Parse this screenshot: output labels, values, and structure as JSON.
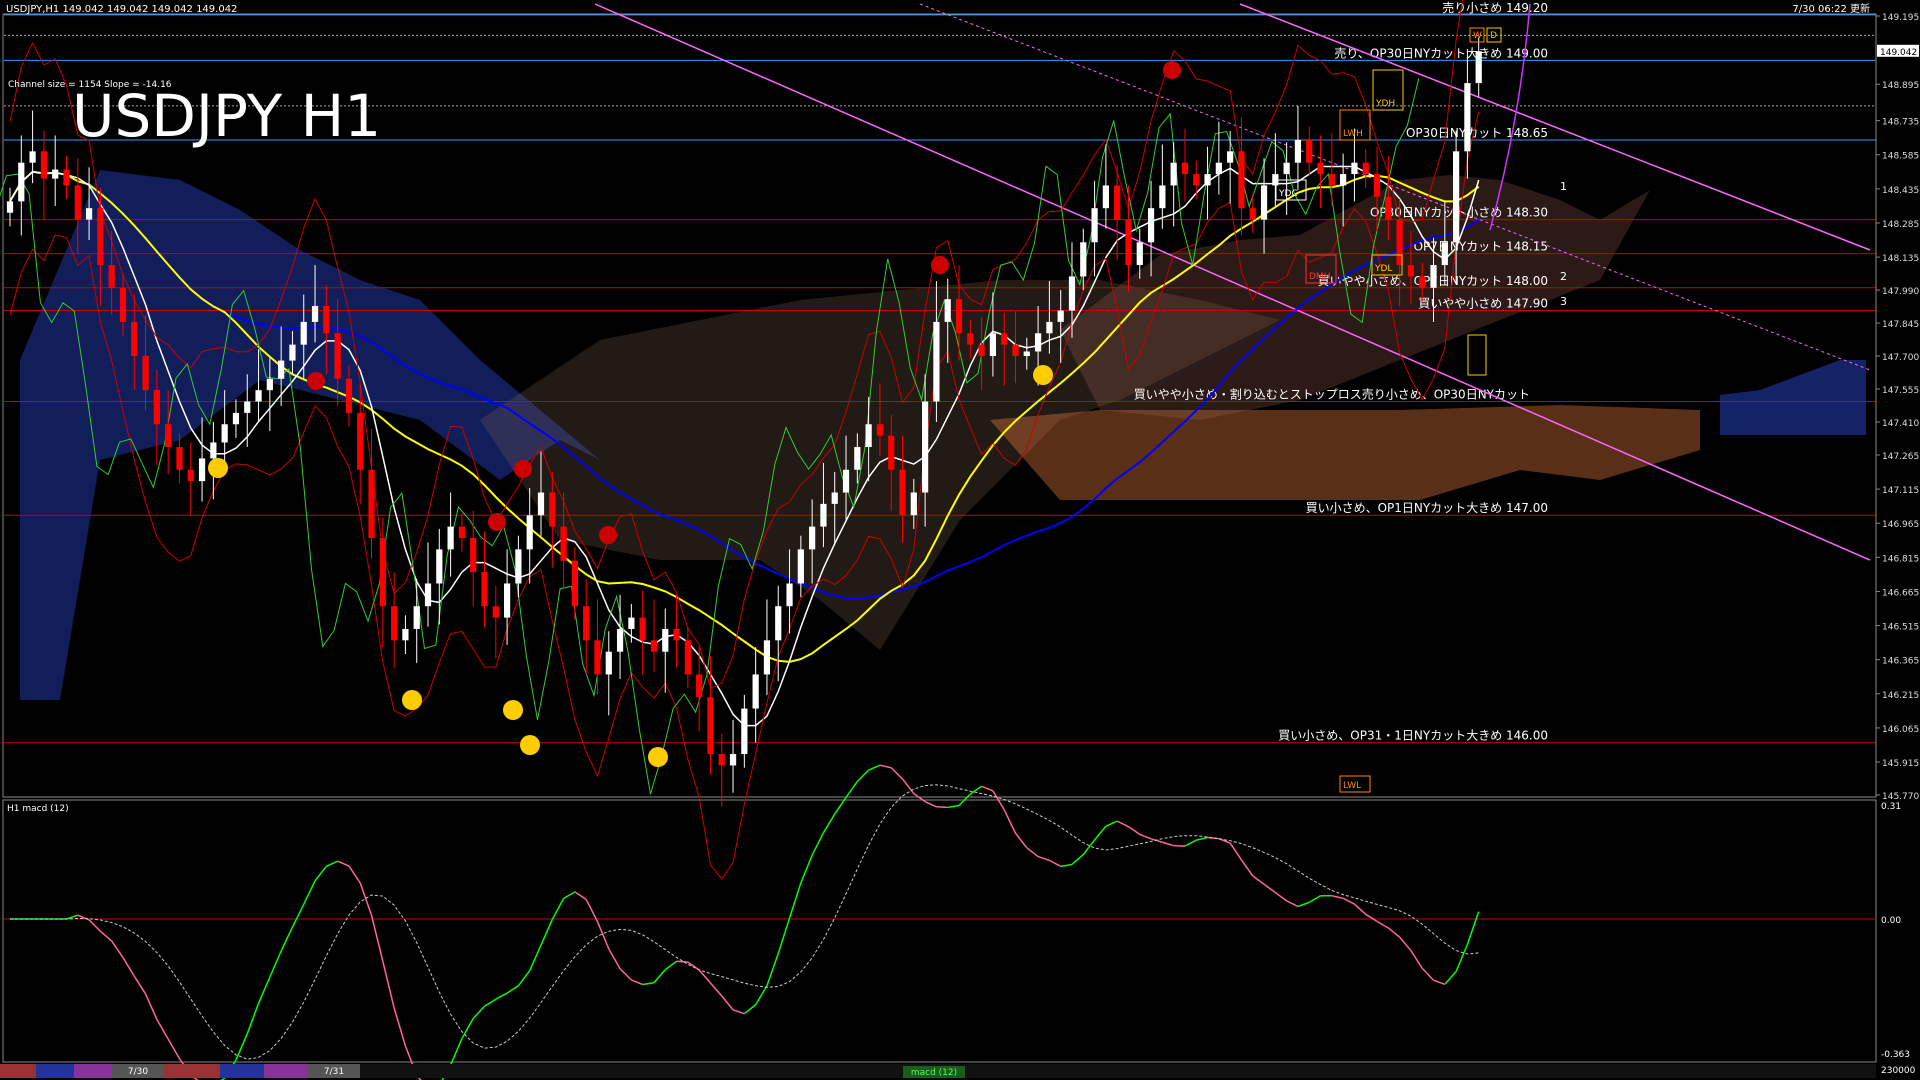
{
  "header": {
    "symbol_info": "USDJPY,H1  149.042 149.042 149.042 149.042",
    "update_time": "7/30 06:22 更新",
    "channel_info": "Channel size = 1154 Slope = -14.16",
    "big_title": "USDJPY H1"
  },
  "indicator": {
    "label": "H1  macd (12)",
    "top_value": "0.31",
    "zero_value": "0.00",
    "bottom_value": "-0.363",
    "bottom_scale": "230000"
  },
  "price_axis": {
    "ticks": [
      "149.195",
      "149.042",
      "148.895",
      "148.735",
      "148.585",
      "148.435",
      "148.285",
      "148.135",
      "147.990",
      "147.845",
      "147.700",
      "147.555",
      "147.410",
      "147.265",
      "147.115",
      "146.965",
      "146.815",
      "146.665",
      "146.515",
      "146.365",
      "146.215",
      "146.065",
      "145.915",
      "145.770"
    ],
    "current_price": "149.042"
  },
  "annotations": [
    {
      "text": "売り小さめ 149.20",
      "level": 149.2,
      "color": "#ffffff"
    },
    {
      "text": "売り、OP30日NYカット大きめ 149.00",
      "level": 149.0,
      "color": "#ffffff"
    },
    {
      "text": "OP30日NYカット 148.65",
      "level": 148.65,
      "color": "#ffffff"
    },
    {
      "text": "OP30日NYカット小さめ 148.30",
      "level": 148.3,
      "color": "#ffffff"
    },
    {
      "text": "OP7日NYカット 148.15",
      "level": 148.15,
      "color": "#ffffff"
    },
    {
      "text": "買いやや小さめ、OP7日NYカット 148.00",
      "level": 148.0,
      "color": "#ffffff"
    },
    {
      "text": "買いやや小さめ 147.90",
      "level": 147.9,
      "color": "#ffffff"
    },
    {
      "text": "買いやや小さめ・割り込むとストップロス売り小さめ、OP30日NYカット",
      "level": 147.5,
      "color": "#ffffff"
    },
    {
      "text": "買い小さめ、OP1日NYカット大きめ 147.00",
      "level": 147.0,
      "color": "#ffffff"
    },
    {
      "text": "買い小さめ、OP31・1日NYカット大きめ 146.00",
      "level": 146.0,
      "color": "#ffffff"
    }
  ],
  "box_labels": [
    "YDH",
    "LWH",
    "YDC",
    "DMH",
    "YDL",
    "LWL",
    "W",
    "D"
  ],
  "channel_marks": [
    "1",
    "2",
    "3"
  ],
  "date_marks": [
    "7/30",
    "7/31"
  ],
  "tab_label": "macd (12)",
  "colors": {
    "bull": "#ffffff",
    "bear": "#ff0000",
    "ma_fast": "#ffffff",
    "ma_mid": "#ffff00",
    "ma_slow": "#0000ff",
    "kumo_blue": "#3355ff",
    "kumo_orange": "#ff8844",
    "channel": "#ff66ff",
    "macd_up": "#00ff00",
    "macd_down": "#ff6699",
    "line_red": "#cc0000",
    "line_blue": "#3399ff"
  },
  "chart_data": {
    "type": "candlestick",
    "title": "USDJPY H1",
    "ylim": [
      145.77,
      149.195
    ],
    "close": [
      148.38,
      148.55,
      148.6,
      148.48,
      148.52,
      148.45,
      148.3,
      148.35,
      148.1,
      148.0,
      147.85,
      147.7,
      147.55,
      147.4,
      147.3,
      147.2,
      147.15,
      147.25,
      147.32,
      147.4,
      147.45,
      147.5,
      147.55,
      147.6,
      147.68,
      147.75,
      147.85,
      147.92,
      147.8,
      147.6,
      147.45,
      147.2,
      146.9,
      146.6,
      146.45,
      146.5,
      146.6,
      146.7,
      146.85,
      146.95,
      146.9,
      146.75,
      146.6,
      146.55,
      146.7,
      146.85,
      147.0,
      147.1,
      146.95,
      146.8,
      146.6,
      146.45,
      146.3,
      146.4,
      146.5,
      146.55,
      146.45,
      146.4,
      146.5,
      146.45,
      146.3,
      146.2,
      145.95,
      145.9,
      145.95,
      146.15,
      146.3,
      146.45,
      146.6,
      146.7,
      146.85,
      146.95,
      147.05,
      147.1,
      147.2,
      147.3,
      147.4,
      147.35,
      147.2,
      147.0,
      147.1,
      147.5,
      147.85,
      147.95,
      147.8,
      147.75,
      147.7,
      147.8,
      147.75,
      147.7,
      147.72,
      147.8,
      147.85,
      147.9,
      148.05,
      148.2,
      148.35,
      148.45,
      148.3,
      148.1,
      148.2,
      148.35,
      148.45,
      148.55,
      148.5,
      148.45,
      148.5,
      148.55,
      148.6,
      148.35,
      148.3,
      148.45,
      148.5,
      148.55,
      148.65,
      148.55,
      148.5,
      148.45,
      148.5,
      148.55,
      148.5,
      148.4,
      148.3,
      148.1,
      148.05,
      148.0,
      148.1,
      148.2,
      148.6,
      148.9,
      149.04
    ]
  }
}
